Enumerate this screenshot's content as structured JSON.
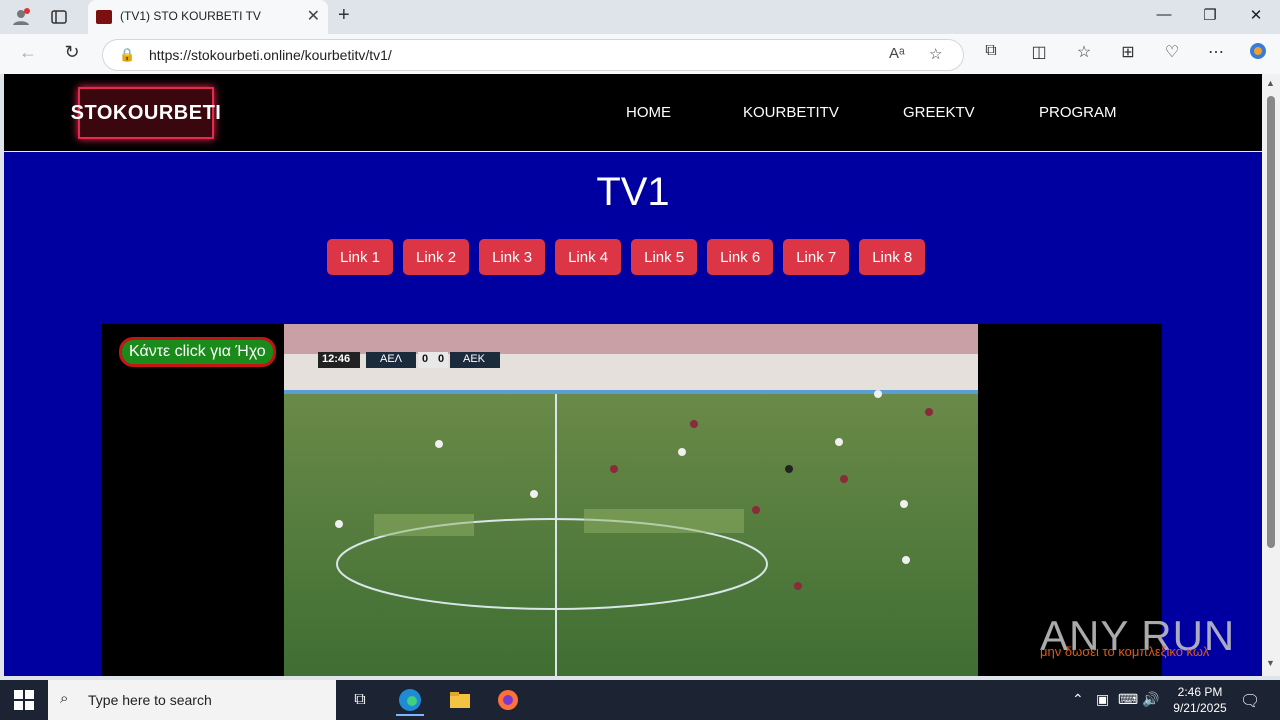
{
  "browser": {
    "tab_title": "(TV1) STO KOURBETI TV",
    "url": "https://stokourbeti.online/kourbetitv/tv1/"
  },
  "site": {
    "logo": "STOKOURBETI",
    "nav": [
      "HOME",
      "KOURBETITV",
      "GREEKTV",
      "PROGRAM"
    ],
    "page_title": "TV1",
    "links": [
      "Link 1",
      "Link 2",
      "Link 3",
      "Link 4",
      "Link 5",
      "Link 6",
      "Link 7",
      "Link 8"
    ],
    "sound_button": "Κάντε click για Ήχο",
    "scoreboard": {
      "time": "12:46",
      "home": "ΑΕΛ",
      "home_score": "0",
      "away_score": "0",
      "away": "ΑΕΚ"
    },
    "overlay_text": "μην δωσει το κομπλεξικο κωλ"
  },
  "watermark": "ANY RUN",
  "taskbar": {
    "search_placeholder": "Type here to search",
    "time": "2:46 PM",
    "date": "9/21/2025"
  }
}
